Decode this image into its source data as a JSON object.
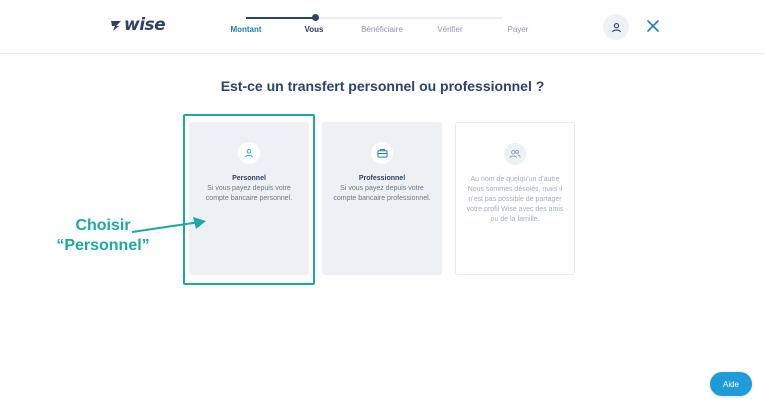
{
  "header": {
    "logo_text": "wise",
    "steps": [
      {
        "label": "Montant",
        "state": "done"
      },
      {
        "label": "Vous",
        "state": "current"
      },
      {
        "label": "Bénéficiaire",
        "state": "upcoming"
      },
      {
        "label": "Vérifier",
        "state": "upcoming"
      },
      {
        "label": "Payer",
        "state": "upcoming"
      }
    ],
    "progress_fraction": 0.27,
    "user_icon": "user-icon",
    "close_icon": "close-icon"
  },
  "main": {
    "title": "Est-ce un transfert personnel ou professionnel ?",
    "options": [
      {
        "icon": "person-icon",
        "title": "Personnel",
        "description": "Si vous payez depuis votre compte bancaire personnel."
      },
      {
        "icon": "briefcase-icon",
        "title": "Professionnel",
        "description": "Si vous payez depuis votre compte bancaire professionnel."
      },
      {
        "icon": "people-icon",
        "title": "Au nom de quelqu'un d'autre",
        "description": "Nous sommes désolés, mais il n'est pas possible de partager votre profil Wise avec des amis ou de la famille."
      }
    ]
  },
  "annotation": {
    "line1": "Choisir",
    "line2": "“Personnel”"
  },
  "help": {
    "label": "Aide"
  },
  "colors": {
    "brand_navy": "#2e4369",
    "accent_blue": "#1f9bd9",
    "annotation_teal": "#1aa9a6",
    "card_bg": "#eef1f4"
  }
}
